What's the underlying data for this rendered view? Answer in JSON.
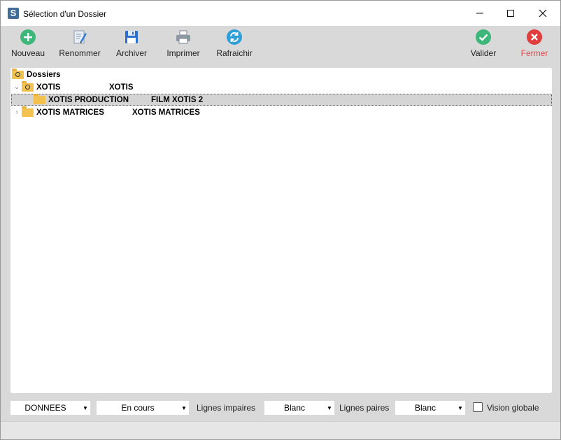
{
  "window": {
    "title": "Sélection d'un Dossier",
    "app_icon_letter": "S"
  },
  "toolbar": {
    "nouveau": "Nouveau",
    "renommer": "Renommer",
    "archiver": "Archiver",
    "imprimer": "Imprimer",
    "rafraichir": "Rafraichir",
    "valider": "Valider",
    "fermer": "Fermer"
  },
  "colors": {
    "accent_green": "#3db67a",
    "accent_red": "#e23d3d",
    "fermer_text": "#e04a4a",
    "refresh_blue": "#2f9fd8",
    "archive_blue": "#2b6fd1"
  },
  "tree": {
    "root": "Dossiers",
    "items": [
      {
        "name": "XOTIS",
        "desc": "XOTIS",
        "expander": "⌄",
        "icon": "folder-search-icon"
      },
      {
        "name": "XOTIS PRODUCTION",
        "desc": "FILM XOTIS 2",
        "selected": true,
        "icon": "folder-icon"
      },
      {
        "name": "XOTIS MATRICES",
        "desc": "XOTIS MATRICES",
        "expander": "›",
        "icon": "folder-icon"
      }
    ]
  },
  "filters": {
    "donnees": "DONNEES",
    "statut": "En cours",
    "lignes_impaires_label": "Lignes impaires",
    "lignes_impaires": "Blanc",
    "lignes_paires_label": "Lignes paires",
    "lignes_paires": "Blanc",
    "vision_globale_label": "Vision globale",
    "vision_globale_checked": false
  }
}
